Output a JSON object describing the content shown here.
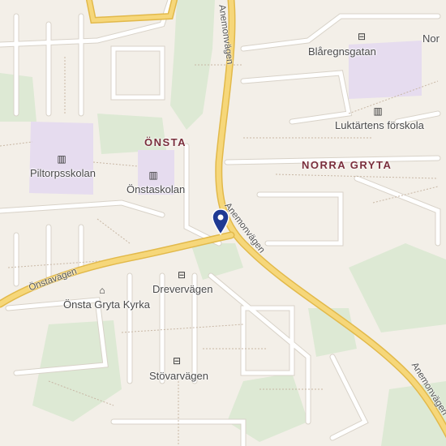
{
  "colors": {
    "background": "#f3efe8",
    "park": "#dde9d4",
    "school_area": "#e6dcef",
    "main_road": "#f6d77a",
    "main_road_casing": "#e2b94a",
    "street": "#ffffff",
    "street_casing": "#d8d2c8",
    "path": "#c8b7a5",
    "pin": "#1f3a93",
    "area_label": "#7a2e3c"
  },
  "areas": {
    "onsta": "ÖNSTA",
    "norra_gryta": "NORRA GRYTA"
  },
  "pois": {
    "piltorpsskolan": {
      "name": "Piltorpsskolan",
      "icon": "school-icon"
    },
    "onstaskolan": {
      "name": "Önstaskolan",
      "icon": "school-icon"
    },
    "luktartens": {
      "name": "Luktärtens förskola",
      "icon": "school-icon"
    },
    "blaregnsgatan": {
      "name": "Blåregnsgatan",
      "icon": "bus-stop-icon"
    },
    "norra_edge": {
      "name": "Nor",
      "icon": "bus-stop-icon"
    },
    "drevervagen": {
      "name": "Drevervägen",
      "icon": "bus-stop-icon"
    },
    "stovarvagen": {
      "name": "Stövarvägen",
      "icon": "bus-stop-icon"
    },
    "kyrka": {
      "name": "Önsta Gryta Kyrka",
      "icon": "church-icon"
    }
  },
  "roads": {
    "anemonvagen_north": "Anemonvägen",
    "anemonvagen_mid": "Anemonvägen",
    "anemonvagen_south": "Anemonvägen",
    "onstavagen": "Önstavägen"
  },
  "marker": {
    "icon": "location-pin-icon"
  }
}
